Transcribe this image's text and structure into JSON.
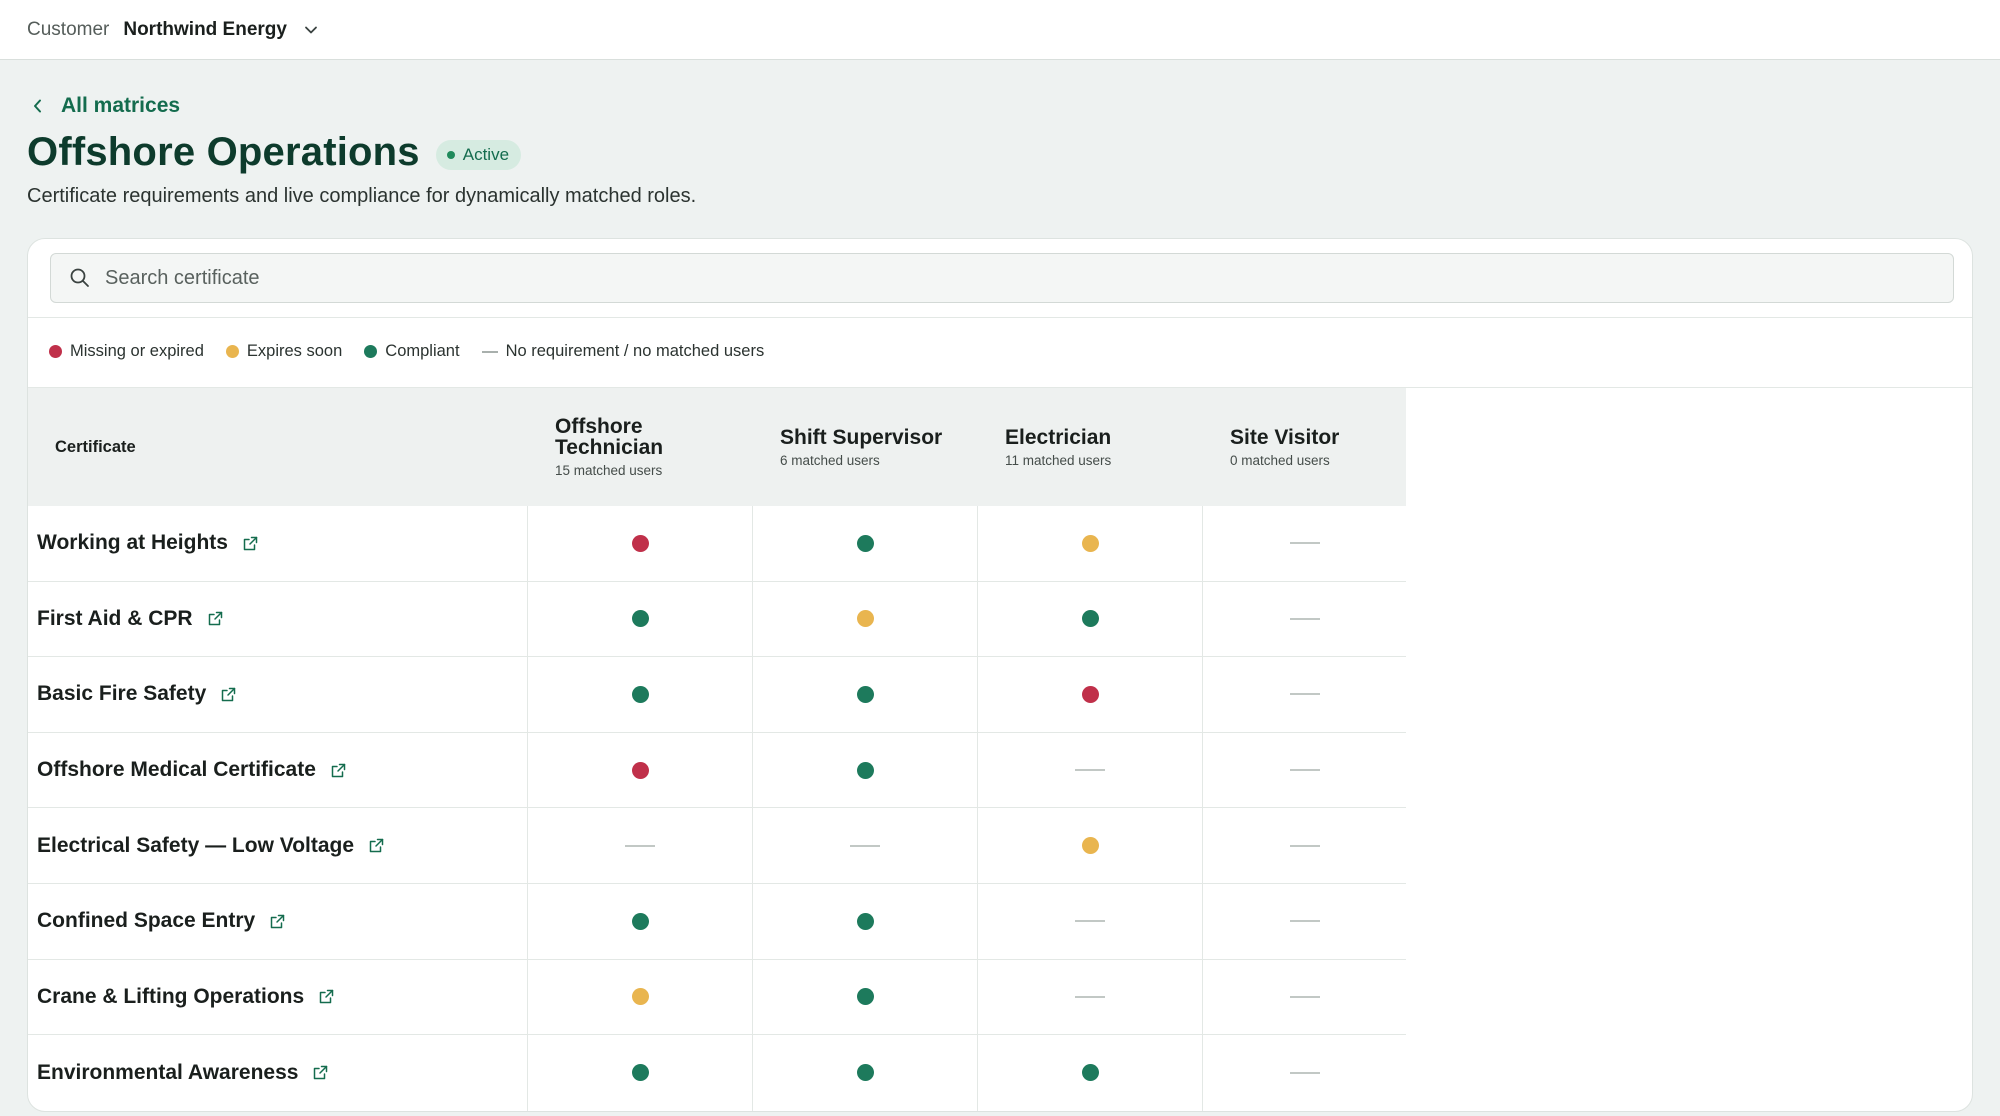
{
  "topbar": {
    "customer_label": "Customer",
    "customer_name": "Northwind Energy",
    "dropdown_icon": "chevron-down-icon"
  },
  "header": {
    "back_label": "All matrices",
    "title": "Offshore Operations",
    "status": "Active",
    "subtitle": "Certificate requirements and live compliance for dynamically matched roles."
  },
  "search": {
    "placeholder": "Search certificate",
    "value": ""
  },
  "legend": {
    "missing": "Missing or expired",
    "soon": "Expires soon",
    "ok": "Compliant",
    "none": "No requirement / no matched users"
  },
  "colors": {
    "missing": "#c0304a",
    "soon": "#e9b54f",
    "ok": "#1d7a5c",
    "brand": "#146c4e"
  },
  "table": {
    "cert_header": "Certificate",
    "roles": [
      {
        "name": "Offshore Technician",
        "count": "15 matched users"
      },
      {
        "name": "Shift Supervisor",
        "count": "6 matched users"
      },
      {
        "name": "Electrician",
        "count": "11 matched users"
      },
      {
        "name": "Site Visitor",
        "count": "0 matched users"
      }
    ],
    "rows": [
      {
        "certificate": "Working at Heights",
        "status": [
          "missing",
          "ok",
          "soon",
          "none"
        ]
      },
      {
        "certificate": "First Aid & CPR",
        "status": [
          "ok",
          "soon",
          "ok",
          "none"
        ]
      },
      {
        "certificate": "Basic Fire Safety",
        "status": [
          "ok",
          "ok",
          "missing",
          "none"
        ]
      },
      {
        "certificate": "Offshore Medical Certificate",
        "status": [
          "missing",
          "ok",
          "none",
          "none"
        ]
      },
      {
        "certificate": "Electrical Safety — Low Voltage",
        "status": [
          "none",
          "none",
          "soon",
          "none"
        ]
      },
      {
        "certificate": "Confined Space Entry",
        "status": [
          "ok",
          "ok",
          "none",
          "none"
        ]
      },
      {
        "certificate": "Crane & Lifting Operations",
        "status": [
          "soon",
          "ok",
          "none",
          "none"
        ]
      },
      {
        "certificate": "Environmental Awareness",
        "status": [
          "ok",
          "ok",
          "ok",
          "none"
        ]
      }
    ]
  }
}
